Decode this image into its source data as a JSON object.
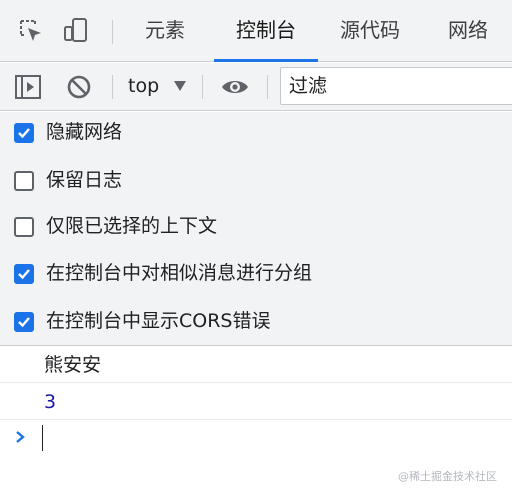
{
  "tabbar": {
    "tabs": [
      {
        "label": "元素",
        "active": false
      },
      {
        "label": "控制台",
        "active": true
      },
      {
        "label": "源代码",
        "active": false
      },
      {
        "label": "网络",
        "active": false
      }
    ],
    "icons": [
      "inspect-element-icon",
      "device-toolbar-icon"
    ],
    "accent_color": "#1a73e8"
  },
  "toolbar": {
    "icons": [
      "sidebar-toggle-icon",
      "clear-console-icon",
      "live-expression-eye-icon"
    ],
    "context_label": "top",
    "filter_placeholder": "过滤"
  },
  "settings": {
    "options": [
      {
        "label": "隐藏网络",
        "checked": true
      },
      {
        "label": "保留日志",
        "checked": false
      },
      {
        "label": "仅限已选择的上下文",
        "checked": false
      },
      {
        "label": "在控制台中对相似消息进行分组",
        "checked": true
      },
      {
        "label": "在控制台中显示CORS错误",
        "checked": true
      }
    ],
    "checkbox_color": "#1a73e8"
  },
  "console": {
    "log_message": "熊安安",
    "result_value": "3",
    "result_color": "#1a1aa6",
    "prompt_color": "#1a73e8"
  },
  "watermark": "@稀土掘金技术社区"
}
